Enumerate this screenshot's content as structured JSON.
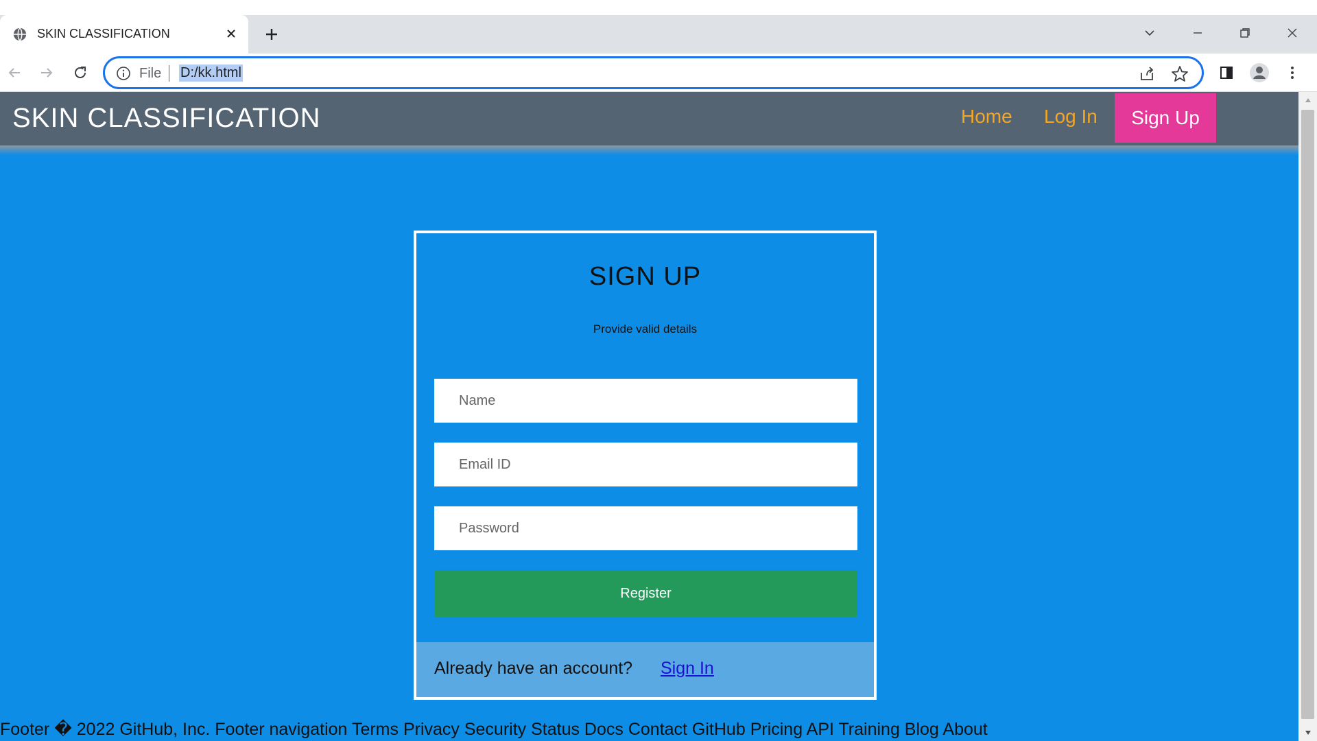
{
  "browser": {
    "tab_title": "SKIN CLASSIFICATION",
    "address_scheme": "File",
    "address_url": "D:/kk.html"
  },
  "site": {
    "brand": "SKIN CLASSIFICATION",
    "nav": {
      "home": "Home",
      "login": "Log In",
      "signup": "Sign Up"
    }
  },
  "form": {
    "title": "SIGN UP",
    "subtitle": "Provide valid details",
    "name_placeholder": "Name",
    "email_placeholder": "Email ID",
    "password_placeholder": "Password",
    "register_label": "Register",
    "footer_text": "Already have an account?",
    "signin_link": "Sign In"
  },
  "page_footer": "Footer � 2022 GitHub, Inc. Footer navigation Terms Privacy Security Status Docs Contact GitHub Pricing API Training Blog About",
  "colors": {
    "page_bg": "#0e8de6",
    "nav_bg": "#546473",
    "nav_link": "#f5a623",
    "signup_bg": "#e5399a",
    "register_bg": "#23995a",
    "card_footer_bg": "#5ba9e2"
  }
}
